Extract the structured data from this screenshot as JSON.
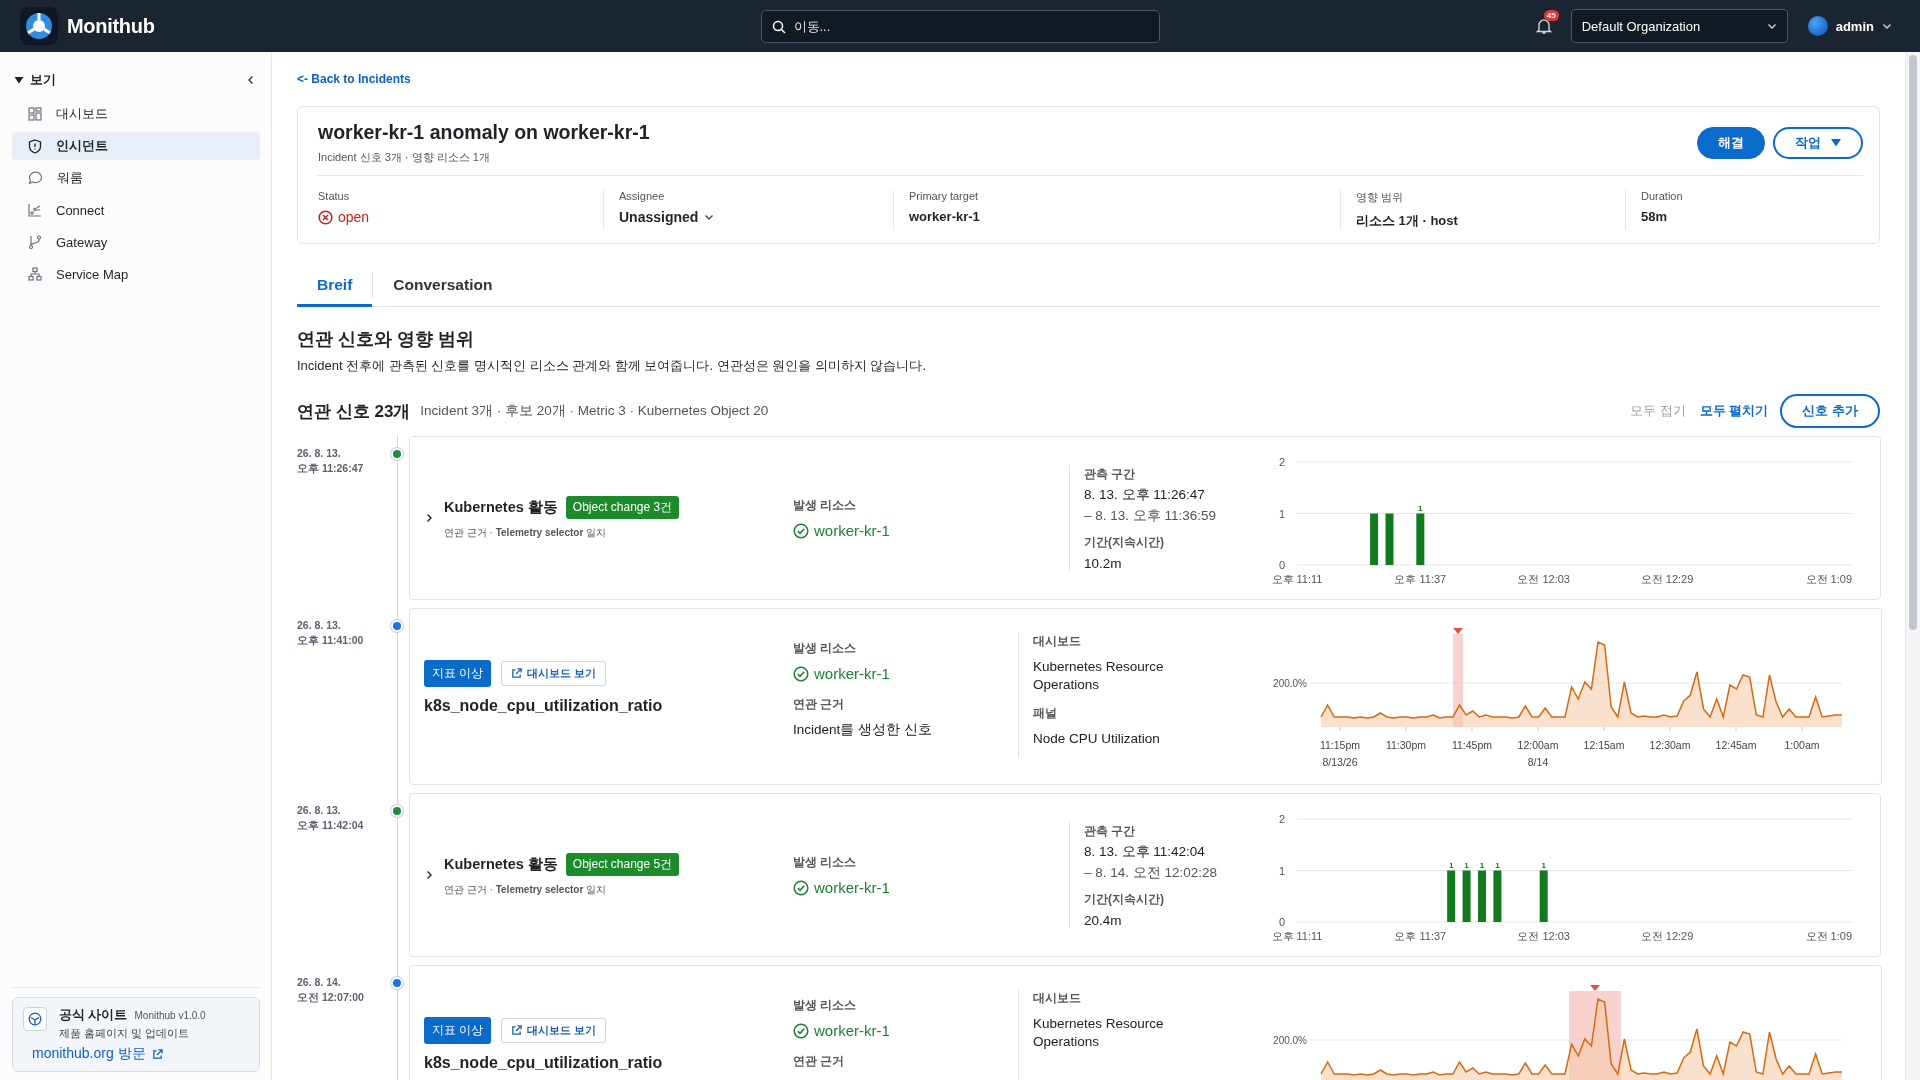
{
  "app": {
    "brand": "Monithub",
    "search_placeholder": "이동...",
    "notification_count": "45",
    "organization": "Default Organization",
    "user": "admin"
  },
  "sidebar": {
    "section": "보기",
    "expanded": true,
    "items": [
      {
        "label": "대시보드",
        "selected": false
      },
      {
        "label": "인시던트",
        "selected": true
      },
      {
        "label": "워룸",
        "selected": false
      },
      {
        "label": "Connect",
        "selected": false
      },
      {
        "label": "Gateway",
        "selected": false
      },
      {
        "label": "Service Map",
        "selected": false
      }
    ],
    "footer": {
      "title": "공식 사이트",
      "version": "Monithub v1.0.0",
      "description": "제품 홈페이지 및 업데이트",
      "link": "monithub.org 방문"
    }
  },
  "incident": {
    "back_link": "<- Back to Incidents",
    "title": "worker-kr-1 anomaly on worker-kr-1",
    "subtitle": "Incident 신호 3개 · 영향 리소스 1개",
    "actions": [
      {
        "label": "해결",
        "kind": "primary"
      },
      {
        "label": "작업",
        "kind": "menu"
      }
    ],
    "fields": [
      {
        "label": "Status",
        "value": "open",
        "kind": "status"
      },
      {
        "label": "Assignee",
        "value": "Unassigned",
        "kind": "dropdown"
      },
      {
        "label": "Primary target",
        "value": "worker-kr-1",
        "kind": "text"
      },
      {
        "label": "영향 범위",
        "value": "리소스 1개 · host",
        "kind": "text"
      },
      {
        "label": "Duration",
        "value": "58m",
        "kind": "text"
      }
    ]
  },
  "tabs": [
    {
      "label": "Breif",
      "selected": true
    },
    {
      "label": "Conversation",
      "selected": false
    }
  ],
  "section": {
    "title": "연관 신호와 영향 범위",
    "description": "Incident 전후에 관측된 신호를 명시적인 리소스 관계와 함께 보여줍니다. 연관성은 원인을 의미하지 않습니다."
  },
  "signals_header": {
    "title": "연관 신호 23개",
    "summary": "Incident 3개 · 후보 20개 · Metric 3 · Kubernetes Object 20",
    "actions": [
      {
        "label": "모두 접기",
        "kind": "text",
        "disabled": true
      },
      {
        "label": "모두 펼치기",
        "kind": "text",
        "disabled": false
      },
      {
        "label": "신호 추가",
        "kind": "outline",
        "disabled": false
      }
    ]
  },
  "signals": [
    {
      "kind": "k8s",
      "date": "26. 8. 13.",
      "time": "오후 11:26:47",
      "color": "#1e8e3e",
      "expanded": false,
      "title": "Kubernetes 활동",
      "badge": "Object change 3건",
      "evidence": "연관 근거 · **Telemetry selector** 일치",
      "resource_label": "발생 리소스",
      "resource": "worker-kr-1",
      "range_label": "관측 구간",
      "range_start": "8. 13. 오후 11:26:47",
      "range_end": "– 8. 13. 오후 11:36:59",
      "duration_label": "기간(지속시간)",
      "duration": "10.2m",
      "chart_data": {
        "type": "bar",
        "categories": [
          "오후 11:11",
          null,
          null,
          null,
          null,
          null,
          null,
          null,
          "오후 11:37",
          null,
          null,
          null,
          null,
          null,
          null,
          null,
          "오전 12:03",
          null,
          null,
          null,
          null,
          null,
          null,
          null,
          "오전 12:29",
          null,
          null,
          null,
          null,
          null,
          null,
          null,
          null,
          null,
          null,
          null,
          "오전 1:09"
        ],
        "values": [
          null,
          null,
          null,
          null,
          null,
          1,
          1,
          null,
          1,
          null,
          null,
          null,
          null,
          null,
          null,
          null,
          null,
          null,
          null,
          null,
          null,
          null,
          null,
          null,
          null,
          null,
          null,
          null,
          null,
          null,
          null,
          null,
          null,
          null,
          null,
          null,
          null
        ],
        "value_labels": [
          null,
          null,
          null,
          null,
          null,
          null,
          null,
          null,
          "1",
          null,
          null,
          null,
          null,
          null,
          null,
          null,
          null,
          null,
          null,
          null,
          null,
          null,
          null,
          null,
          null,
          null,
          null,
          null,
          null,
          null,
          null,
          null,
          null,
          null,
          null,
          null,
          null
        ],
        "ylim": [
          0,
          2
        ],
        "yticks": [
          0,
          1,
          2
        ]
      }
    },
    {
      "kind": "metric",
      "date": "26. 8. 13.",
      "time": "오후 11:41:00",
      "color": "#1a73e8",
      "badge": "지표 이상",
      "link": "대시보드 보기",
      "title": "k8s_node_cpu_utilization_ratio",
      "resource_label": "발생 리소스",
      "resource": "worker-kr-1",
      "evidence_label": "연관 근거",
      "evidence": "Incident를 생성한 신호",
      "dashboard_label": "대시보드",
      "dashboard": "Kubernetes Resource Operations",
      "panel_label": "패널",
      "panel": "Node CPU Utilization",
      "spark": {
        "y_label": "200.0%",
        "x_labels": [
          {
            "time": "11:15pm",
            "date": "8/13/26"
          },
          {
            "time": "11:30pm"
          },
          {
            "time": "11:45pm"
          },
          {
            "time": "12:00am",
            "date": "8/14"
          },
          {
            "time": "12:15am"
          },
          {
            "time": "12:30am"
          },
          {
            "time": "12:45am"
          },
          {
            "time": "1:00am"
          }
        ]
      }
    },
    {
      "kind": "k8s",
      "date": "26. 8. 13.",
      "time": "오후 11:42:04",
      "color": "#1e8e3e",
      "expanded": false,
      "title": "Kubernetes 활동",
      "badge": "Object change 5건",
      "evidence": "연관 근거 · **Telemetry selector** 일치",
      "resource_label": "발생 리소스",
      "resource": "worker-kr-1",
      "range_label": "관측 구간",
      "range_start": "8. 13. 오후 11:42:04",
      "range_end": "– 8. 14. 오전 12:02:28",
      "duration_label": "기간(지속시간)",
      "duration": "20.4m",
      "chart_data": {
        "type": "bar",
        "categories": [
          "오후 11:11",
          null,
          null,
          null,
          null,
          null,
          null,
          null,
          "오후 11:37",
          null,
          null,
          null,
          null,
          null,
          null,
          null,
          "오전 12:03",
          null,
          null,
          null,
          null,
          null,
          null,
          null,
          "오전 12:29",
          null,
          null,
          null,
          null,
          null,
          null,
          null,
          null,
          null,
          null,
          null,
          "오전 1:09"
        ],
        "values": [
          null,
          null,
          null,
          null,
          null,
          null,
          null,
          null,
          null,
          null,
          1,
          1,
          1,
          1,
          null,
          null,
          1,
          null,
          null,
          null,
          null,
          null,
          null,
          null,
          null,
          null,
          null,
          null,
          null,
          null,
          null,
          null,
          null,
          null,
          null,
          null,
          null
        ],
        "value_labels": [
          null,
          null,
          null,
          null,
          null,
          null,
          null,
          null,
          null,
          null,
          "1",
          "1",
          "1",
          "1",
          null,
          null,
          "1",
          null,
          null,
          null,
          null,
          null,
          null,
          null,
          null,
          null,
          null,
          null,
          null,
          null,
          null,
          null,
          null,
          null,
          null,
          null,
          null
        ],
        "ylim": [
          0,
          2
        ],
        "yticks": [
          0,
          1,
          2
        ]
      }
    },
    {
      "kind": "metric",
      "date": "26. 8. 14.",
      "time": "오전 12:07:00",
      "color": "#1a73e8",
      "badge": "지표 이상",
      "link": "대시보드 보기",
      "title": "k8s_node_cpu_utilization_ratio",
      "resource_label": "발생 리소스",
      "resource": "worker-kr-1",
      "evidence_label": "연관 근거",
      "dashboard_label": "대시보드",
      "dashboard": "Kubernetes Resource Operations",
      "spark": {
        "y_label": "200.0%"
      }
    }
  ]
}
